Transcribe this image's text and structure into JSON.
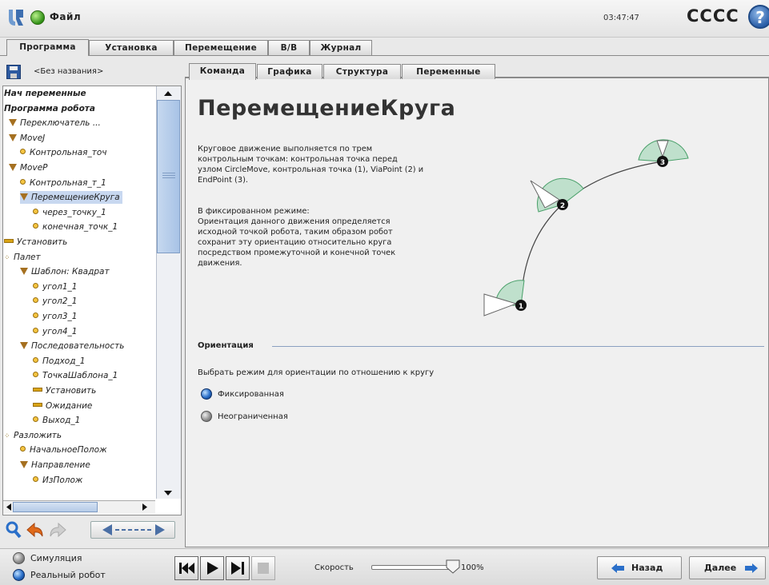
{
  "header": {
    "file_label": "Файл",
    "clock": "03:47:47",
    "robot_name": "CCCC",
    "help": "?"
  },
  "main_tabs": [
    "Программа",
    "Установка",
    "Перемещение",
    "В/В",
    "Журнал"
  ],
  "program": {
    "name": "<Без названия>",
    "tree": [
      {
        "label": "Нач переменные",
        "icon": "none",
        "bold": true
      },
      {
        "label": "Программа робота",
        "icon": "none",
        "bold": true
      },
      {
        "label": "Переключатель ...",
        "icon": "triangle"
      },
      {
        "label": "MoveJ",
        "icon": "triangle"
      },
      {
        "label": "Контрольная_точ",
        "icon": "dot"
      },
      {
        "label": "MoveP",
        "icon": "triangle"
      },
      {
        "label": "Контрольная_т_1",
        "icon": "dot"
      },
      {
        "label": "ПеремещениеКруга",
        "icon": "triangle",
        "selected": true
      },
      {
        "label": "через_точку_1",
        "icon": "dot"
      },
      {
        "label": "конечная_точк_1",
        "icon": "dot"
      },
      {
        "label": "Установить",
        "icon": "dash"
      },
      {
        "label": "Палет",
        "icon": "dots"
      },
      {
        "label": "Шаблон: Квадрат",
        "icon": "triangle"
      },
      {
        "label": "угол1_1",
        "icon": "dot"
      },
      {
        "label": "угол2_1",
        "icon": "dot"
      },
      {
        "label": "угол3_1",
        "icon": "dot"
      },
      {
        "label": "угол4_1",
        "icon": "dot"
      },
      {
        "label": "Последовательность",
        "icon": "triangle"
      },
      {
        "label": "Подход_1",
        "icon": "dot"
      },
      {
        "label": "ТочкаШаблона_1",
        "icon": "dot"
      },
      {
        "label": "Установить",
        "icon": "dash"
      },
      {
        "label": "Ожидание",
        "icon": "dash"
      },
      {
        "label": "Выход_1",
        "icon": "dot"
      },
      {
        "label": "Разложить",
        "icon": "dots"
      },
      {
        "label": "НачальноеПолож",
        "icon": "dot"
      },
      {
        "label": "Направление",
        "icon": "triangle"
      },
      {
        "label": "ИзПолож",
        "icon": "dot"
      }
    ]
  },
  "sub_tabs": [
    "Команда",
    "Графика",
    "Структура",
    "Переменные"
  ],
  "command": {
    "title": "ПеремещениеКруга",
    "para1": [
      "Круговое движение выполняется по трем",
      "контрольным точкам: контрольная точка перед",
      "узлом CircleMove, контрольная точка (1), ViaPoint (2) и",
      "EndPoint (3)."
    ],
    "para2": [
      "В фиксированном режиме:",
      "Ориентация данного движения определяется",
      "исходной точкой робота, таким образом робот",
      "сохранит эту ориентацию относительно круга",
      "посредством промежуточной и конечной точек",
      "движения."
    ],
    "diagram_points": [
      "1",
      "2",
      "3"
    ],
    "section_label": "Ориентация",
    "orient_desc": "Выбрать режим для ориентации по отношению к кругу",
    "radio_fixed": "Фиксированная",
    "radio_free": "Неограниченная",
    "selected_mode": "Фиксированная"
  },
  "footer": {
    "sim_label": "Симуляция",
    "real_label": "Реальный робот",
    "selected_mode": "Реальный робот",
    "speed_label": "Скорость",
    "speed_value": "100%",
    "speed_fraction": 1.0,
    "back_label": "Назад",
    "next_label": "Далее"
  }
}
